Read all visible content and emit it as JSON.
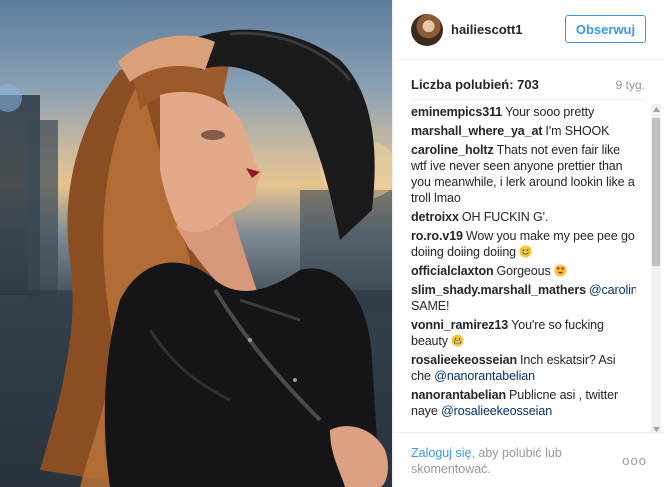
{
  "header": {
    "username": "hailiescott1",
    "follow_label": "Obserwuj"
  },
  "stats": {
    "likes": "Liczba polubień: 703",
    "age": "9 tyg."
  },
  "comments": [
    {
      "author": "eminempics311",
      "text": "Your sooo pretty"
    },
    {
      "author": "marshall_where_ya_at",
      "text": "I'm SHOOK"
    },
    {
      "author": "caroline_holtz",
      "text": "Thats not even fair like wtf ive never seen anyone prettier than you meanwhile, i lerk around lookin like a troll lmao"
    },
    {
      "author": "detroixx",
      "text": "OH FUCKIN G'."
    },
    {
      "author": "ro.ro.v19",
      "text": "Wow you make my pee pee go doiing doiing doiing",
      "emoji": "grinning-face-sweat"
    },
    {
      "author": "officialclaxton",
      "text": "Gorgeous",
      "emoji": "heart-eyes-face"
    },
    {
      "author": "slim_shady.marshall_mathers",
      "mention": "@caroline_holtz",
      "text": "SAME!"
    },
    {
      "author": "vonni_ramirez13",
      "text": "You're so fucking beauty",
      "emoji": "grimacing-face"
    },
    {
      "author": "rosalieekeosseian",
      "text": "Inch eskatsir? Asi che",
      "mention": "@nanorantabelian"
    },
    {
      "author": "nanorantabelian",
      "text": "Publicne asi , twitter naye",
      "mention": "@rosalieekeosseian"
    }
  ],
  "footer": {
    "login_link": "Zaloguj się",
    "login_rest": ", aby polubić lub skomentować.",
    "more": "ooo"
  }
}
